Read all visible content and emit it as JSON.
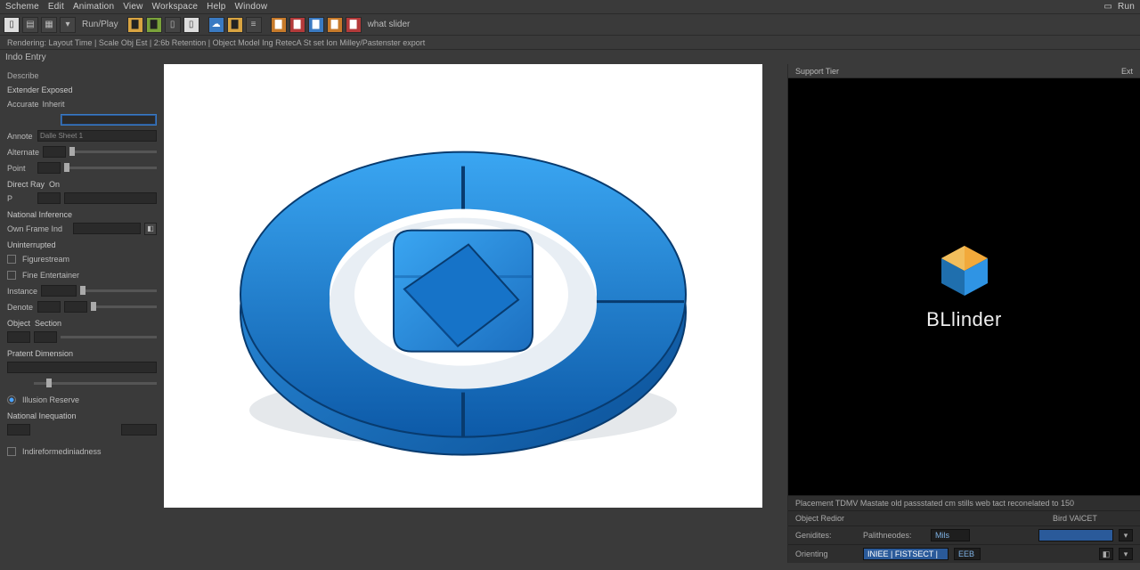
{
  "menu": {
    "items": [
      "Scheme",
      "Edit",
      "Animation",
      "View",
      "Workspace",
      "Help",
      "Window"
    ],
    "runLabel": "Run"
  },
  "toolbar": {
    "runBtn": "Run/Play",
    "icons": [
      "doc",
      "open",
      "save",
      "folder",
      "page",
      "export",
      "import",
      "sep",
      "cloud",
      "folder2",
      "layers",
      "sep",
      "new",
      "open2",
      "box",
      "img",
      "cube",
      "pdf"
    ],
    "tailLabel": "what  slider"
  },
  "status": {
    "text": "Rendering: Layout Time | Scale Obj Est | 2:6b Retention | Object   Model Ing RetecA St set Ion Milley/Pastenster export"
  },
  "tabs": {
    "active": "Indo Entry"
  },
  "leftPanel": {
    "tab": "Describe",
    "header": "Extender Exposed",
    "g1": {
      "lbl1": "Accurate",
      "lbl2": "Inherit",
      "field": ""
    },
    "g2": {
      "lbl": "Annote",
      "val": "Dalle Sheet 1"
    },
    "g3": {
      "lbl": "Alternate",
      "lbl2": "Point"
    },
    "g4": {
      "lbl": "Direct Ray",
      "lbl2": "On",
      "p": "P"
    },
    "g5": {
      "lbl": "National Inference",
      "lbl2": "Own Frame Ind",
      "last": ""
    },
    "g6": {
      "lbl": "Uninterrupted",
      "c1": "Figurestream",
      "c2": "Fine Entertainer"
    },
    "g7": {
      "lbl": "Instance",
      "lbl2": "Denote"
    },
    "g8": {
      "lbl": "Object",
      "lbl2": "Section"
    },
    "g9": {
      "lbl": "Pratent  Dimension",
      "note": ""
    },
    "g10": {
      "opt1": "Illusion  Reserve",
      "opt2": ""
    },
    "g11": {
      "lbl": "National  Inequation",
      "val": "",
      "c": ""
    },
    "g12": {
      "c": "Indireformediniadness"
    }
  },
  "rightPanel": {
    "title": "Support Tier",
    "close": "Ext",
    "brand": "BLlinder",
    "footInfo": "Placement   TDMV Mastate old passstated cm stills web tact reconelated to 150",
    "row1": {
      "l": "Object Redior",
      "r": "Bird VAlCET"
    },
    "row2": {
      "l": "Genidites:",
      "m": "Palithneodes:",
      "mv": "Mils",
      "rv": ""
    },
    "row3": {
      "l": "Orienting",
      "mv": "INIEE | FISTSECT |",
      "rv": "EEB"
    }
  },
  "colors": {
    "accent": "#3a7ac2"
  }
}
